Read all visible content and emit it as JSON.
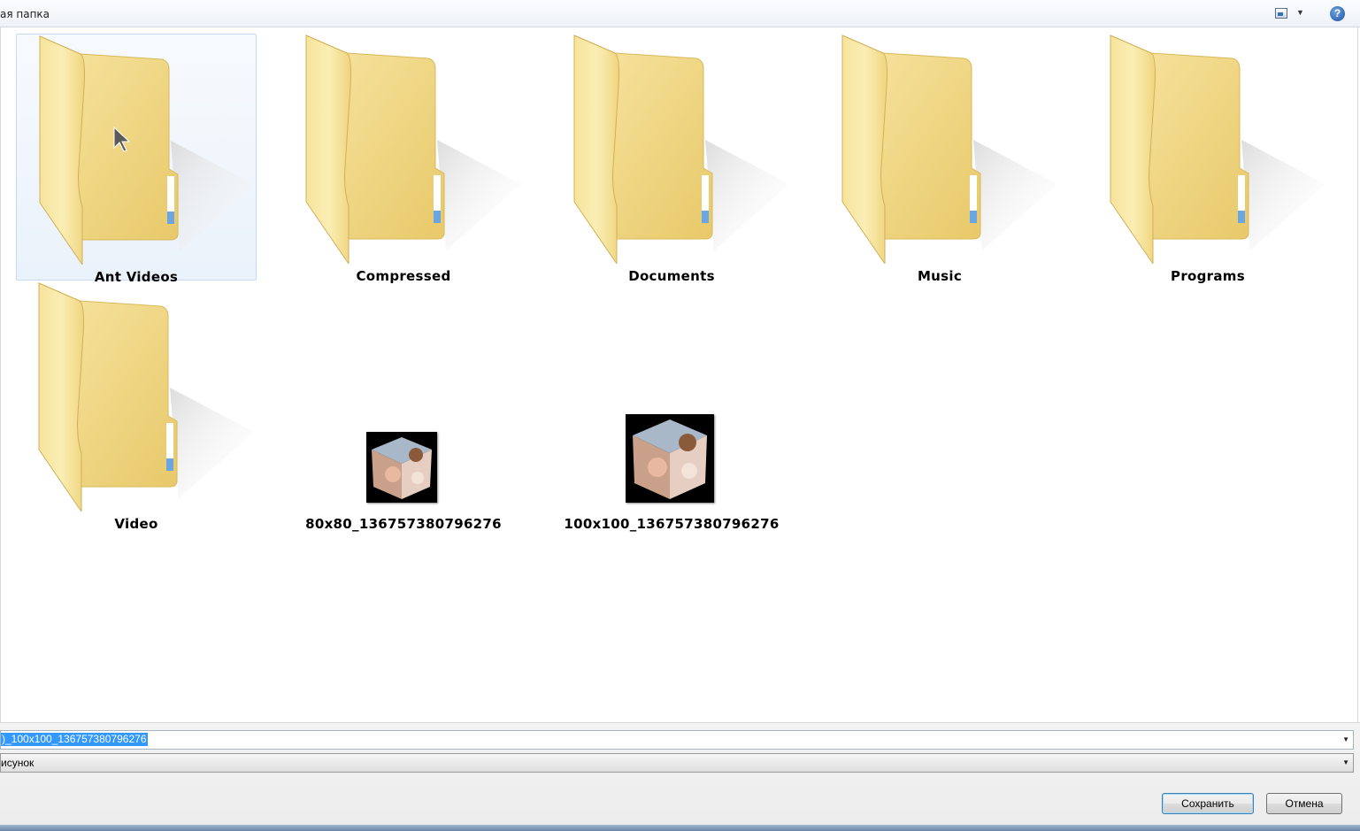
{
  "toolbar": {
    "title": "ая папка",
    "view_icon": "view-options-icon",
    "help_icon": "help-icon",
    "help_glyph": "?"
  },
  "items": [
    {
      "label": "Ant Videos",
      "type": "folder",
      "selected": true
    },
    {
      "label": "Compressed",
      "type": "folder"
    },
    {
      "label": "Documents",
      "type": "folder"
    },
    {
      "label": "Music",
      "type": "folder"
    },
    {
      "label": "Programs",
      "type": "folder"
    },
    {
      "label": "Video",
      "type": "folder"
    },
    {
      "label": "80x80_136757380796276",
      "type": "image"
    },
    {
      "label": "100x100_136757380796276",
      "type": "image"
    }
  ],
  "form": {
    "filename_value": ")_100x100_136757380796276",
    "filetype_value": "исунок"
  },
  "buttons": {
    "save": "Сохранить",
    "cancel": "Отмена"
  },
  "colors": {
    "selection": "#3399ff",
    "folder": "#f3dc8a"
  }
}
